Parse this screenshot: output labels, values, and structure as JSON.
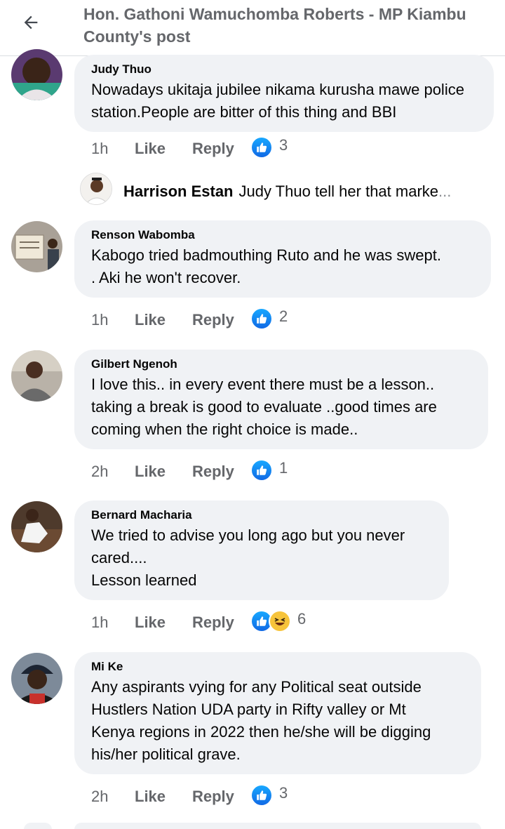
{
  "header": {
    "back_icon": "arrow-left-icon",
    "title": "Hon. Gathoni Wamuchomba Roberts - MP Kiambu County's post"
  },
  "actions": {
    "like_label": "Like",
    "reply_label": "Reply"
  },
  "comments": [
    {
      "author": "Judy Thuo",
      "text": "Nowadays ukitaja jubilee nikama kurusha mawe police station.People are bitter of this thing and BBI",
      "time": "1h",
      "reactions": [
        "like"
      ],
      "reaction_count": "3",
      "reply": {
        "author": "Harrison Estan",
        "text": "Judy Thuo tell her that marke",
        "ellipsis": "..."
      }
    },
    {
      "author": "Renson Wabomba",
      "text": "Kabogo tried badmouthing Ruto and he was swept.\n. Aki he won't recover.",
      "time": "1h",
      "reactions": [
        "like"
      ],
      "reaction_count": "2"
    },
    {
      "author": "Gilbert Ngenoh",
      "text": "I love this.. in every event  there must be a lesson..\ntaking a break is good to evaluate ..good times are\ncoming when the right choice is made..",
      "time": "2h",
      "reactions": [
        "like"
      ],
      "reaction_count": "1"
    },
    {
      "author": "Bernard Macharia",
      "text": "We tried to advise you long ago but you never\ncared....\nLesson learned",
      "time": "1h",
      "reactions": [
        "like",
        "haha"
      ],
      "reaction_count": "6"
    },
    {
      "author": "Mi Ke",
      "text": "Any aspirants vying for any Political seat outside\nHustlers Nation UDA party in Rifty valley or Mt\nKenya regions in 2022 then he/she  will be digging\nhis/her political grave.",
      "time": "2h",
      "reactions": [
        "like"
      ],
      "reaction_count": "3"
    }
  ],
  "colors": {
    "bubble": "#f0f2f5",
    "secondary_text": "#65676b",
    "like_blue": "#1877f2"
  }
}
